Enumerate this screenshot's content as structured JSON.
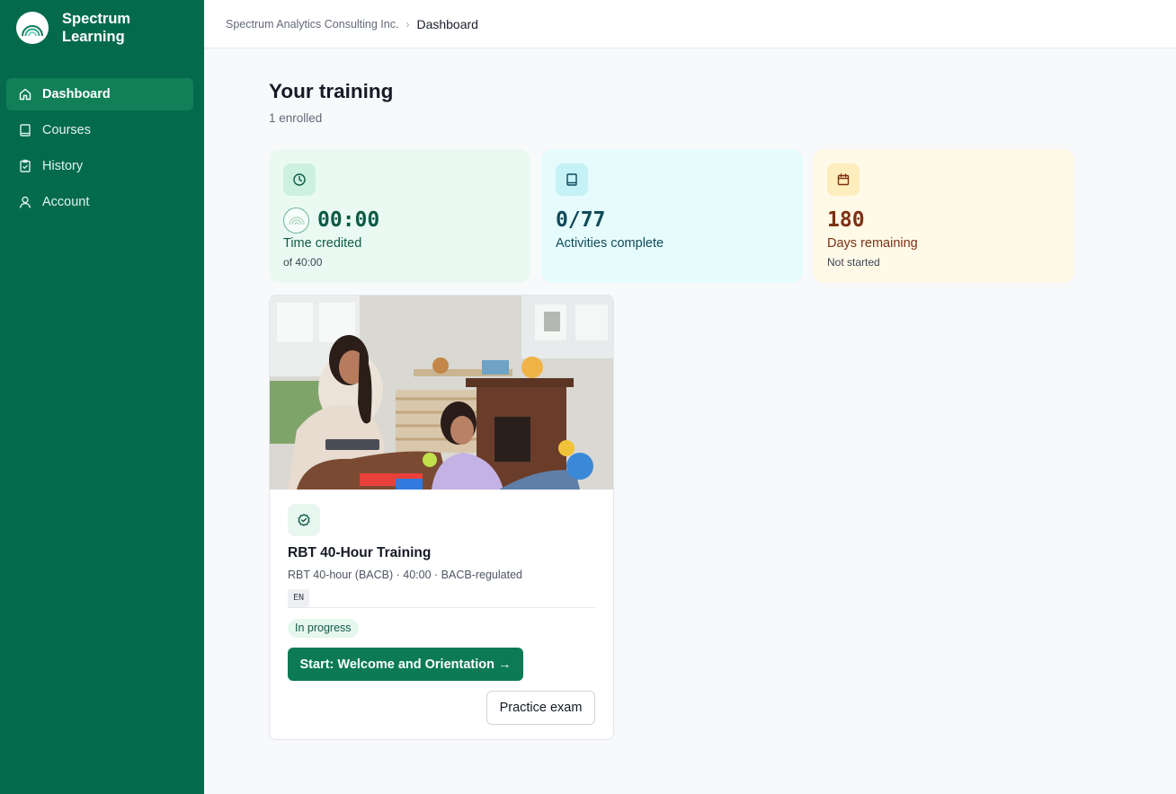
{
  "brand": {
    "name": "Spectrum Learning"
  },
  "nav": [
    {
      "label": "Dashboard",
      "icon": "home-icon",
      "active": true
    },
    {
      "label": "Courses",
      "icon": "book-icon"
    },
    {
      "label": "History",
      "icon": "clipboard-check-icon"
    },
    {
      "label": "Account",
      "icon": "user-icon"
    }
  ],
  "breadcrumb": {
    "org": "Spectrum Analytics Consulting Inc.",
    "current": "Dashboard"
  },
  "page": {
    "title": "Your training",
    "subtitle": "1 enrolled"
  },
  "stats": {
    "time": {
      "icon": "clock-icon",
      "value": "00:00",
      "label": "Time credited",
      "note": "of 40:00",
      "progress": 0
    },
    "activities": {
      "icon": "book-icon",
      "value": "0/77",
      "label": "Activities complete"
    },
    "days": {
      "icon": "calendar-icon",
      "value": "180",
      "label": "Days remaining",
      "note": "Not started"
    }
  },
  "course": {
    "image": "therapist-with-child-photo",
    "badge_icon": "check-badge-icon",
    "title": "RBT 40-Hour Training",
    "meta": "RBT 40-hour (BACB) · 40:00 · BACB-regulated",
    "language": "EN",
    "status": "In progress",
    "start_label": "Start: Welcome and Orientation →",
    "practice_label": "Practice exam"
  },
  "colors": {
    "sidebar": "#036b4c",
    "sidebar_active": "#118058",
    "primary_button": "#0b7a55",
    "stat_green_bg": "#eafaf3",
    "stat_cyan_bg": "#e6fbfc",
    "stat_amber_bg": "#fff9e8"
  }
}
